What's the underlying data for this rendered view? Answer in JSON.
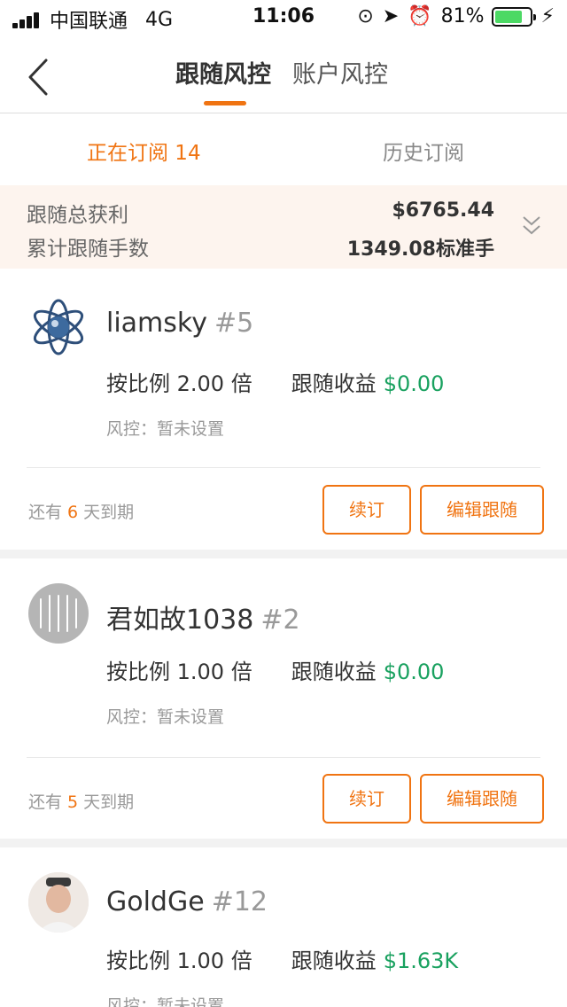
{
  "status_bar": {
    "carrier": "中国联通",
    "network": "4G",
    "time": "11:06",
    "battery": "81%",
    "battery_level": 0.81
  },
  "nav": {
    "tabs": [
      "跟随风控",
      "账户风控"
    ],
    "active_tab": 0
  },
  "subtabs": {
    "current": "正在订阅 14",
    "history": "历史订阅"
  },
  "summary": {
    "total_profit_label": "跟随总获利",
    "total_profit_value": "$6765.44",
    "total_lots_label": "累计跟随手数",
    "total_lots_value": "1349.08标准手"
  },
  "subscriptions": [
    {
      "name": "liamsky",
      "rank": "#5",
      "ratio": "按比例 2.00 倍",
      "gain_label": "跟随收益",
      "gain": "$0.00",
      "risk": "风控：暂未设置",
      "expire_prefix": "还有",
      "expire_days": "6",
      "expire_suffix": "天到期",
      "renew_label": "续订",
      "edit_label": "编辑跟随"
    },
    {
      "name": "君如故1038",
      "rank": "#2",
      "ratio": "按比例 1.00 倍",
      "gain_label": "跟随收益",
      "gain": "$0.00",
      "risk": "风控：暂未设置",
      "expire_prefix": "还有",
      "expire_days": "5",
      "expire_suffix": "天到期",
      "renew_label": "续订",
      "edit_label": "编辑跟随"
    },
    {
      "name": "GoldGe",
      "rank": "#12",
      "ratio": "按比例 1.00 倍",
      "gain_label": "跟随收益",
      "gain": "$1.63K",
      "risk": "风控：暂未设置"
    }
  ],
  "colors": {
    "accent": "#f07412",
    "gain": "#19a15f",
    "summary_bg": "#fdf4ee"
  }
}
